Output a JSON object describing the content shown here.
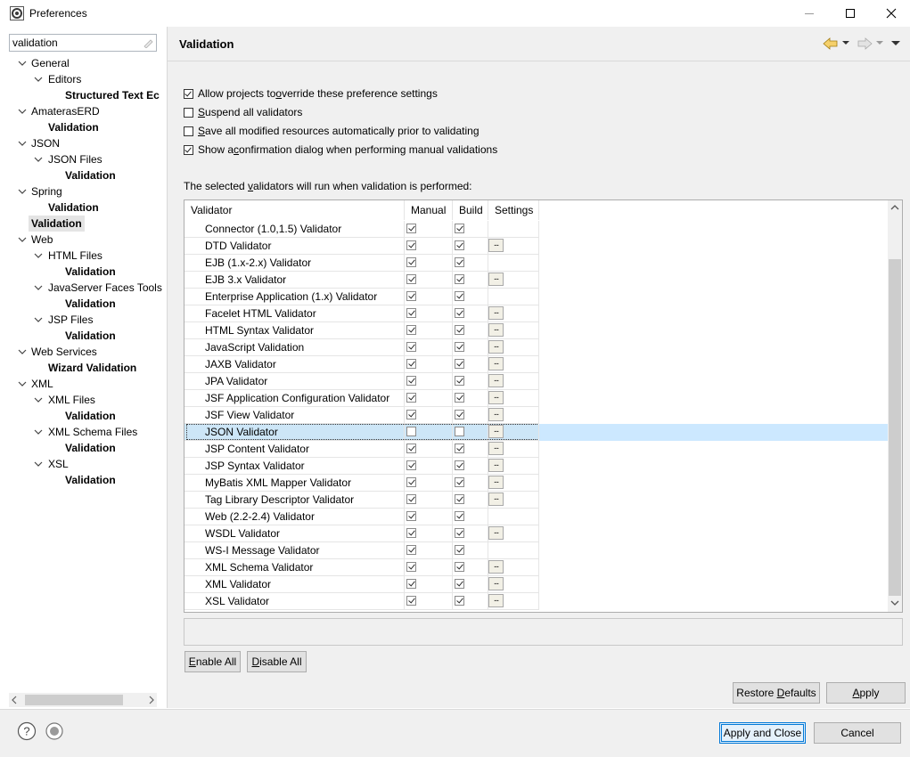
{
  "window": {
    "title": "Preferences",
    "controls": {
      "minimize": "minimize-icon",
      "maximize": "maximize-icon",
      "close": "close-icon"
    }
  },
  "filter": {
    "value": "validation"
  },
  "tree": [
    {
      "label": "General",
      "level": 0,
      "expanded": true,
      "bold": false
    },
    {
      "label": "Editors",
      "level": 1,
      "expanded": true,
      "bold": false
    },
    {
      "label": "Structured Text Ec",
      "level": 2,
      "bold": true
    },
    {
      "label": "AmaterasERD",
      "level": 0,
      "expanded": true,
      "bold": false
    },
    {
      "label": "Validation",
      "level": 1,
      "bold": true,
      "leaf": true
    },
    {
      "label": "JSON",
      "level": 0,
      "expanded": true,
      "bold": false
    },
    {
      "label": "JSON Files",
      "level": 1,
      "expanded": true,
      "bold": false
    },
    {
      "label": "Validation",
      "level": 2,
      "bold": true
    },
    {
      "label": "Spring",
      "level": 0,
      "expanded": true,
      "bold": false
    },
    {
      "label": "Validation",
      "level": 1,
      "bold": true,
      "leaf": true
    },
    {
      "label": "Validation",
      "level": 0,
      "bold": true,
      "selected": true
    },
    {
      "label": "Web",
      "level": 0,
      "expanded": true,
      "bold": false
    },
    {
      "label": "HTML Files",
      "level": 1,
      "expanded": true,
      "bold": false
    },
    {
      "label": "Validation",
      "level": 2,
      "bold": true
    },
    {
      "label": "JavaServer Faces Tools",
      "level": 1,
      "expanded": true,
      "bold": false
    },
    {
      "label": "Validation",
      "level": 2,
      "bold": true
    },
    {
      "label": "JSP Files",
      "level": 1,
      "expanded": true,
      "bold": false
    },
    {
      "label": "Validation",
      "level": 2,
      "bold": true
    },
    {
      "label": "Web Services",
      "level": 0,
      "expanded": true,
      "bold": false
    },
    {
      "label": "Wizard Validation",
      "level": 1,
      "bold": true,
      "leaf": true
    },
    {
      "label": "XML",
      "level": 0,
      "expanded": true,
      "bold": false
    },
    {
      "label": "XML Files",
      "level": 1,
      "expanded": true,
      "bold": false
    },
    {
      "label": "Validation",
      "level": 2,
      "bold": true
    },
    {
      "label": "XML Schema Files",
      "level": 1,
      "expanded": true,
      "bold": false
    },
    {
      "label": "Validation",
      "level": 2,
      "bold": true
    },
    {
      "label": "XSL",
      "level": 1,
      "expanded": true,
      "bold": false
    },
    {
      "label": "Validation",
      "level": 2,
      "bold": true
    }
  ],
  "page": {
    "title": "Validation"
  },
  "options": [
    {
      "pre": "Allow projects to ",
      "u": "o",
      "post": "verride these preference settings",
      "checked": true
    },
    {
      "pre": "",
      "u": "S",
      "post": "uspend all validators",
      "checked": false
    },
    {
      "pre": "",
      "u": "S",
      "post": "ave all modified resources automatically prior to validating",
      "checked": false
    },
    {
      "pre": "Show a ",
      "u": "c",
      "post": "onfirmation dialog when performing manual validations",
      "checked": true
    }
  ],
  "description": {
    "pre": "The selected ",
    "u": "v",
    "post": "alidators will run when validation is performed:"
  },
  "table": {
    "headers": {
      "validator": "Validator",
      "manual": "Manual",
      "build": "Build",
      "settings": "Settings"
    },
    "rows": [
      {
        "name": "Connector (1.0,1.5) Validator",
        "manual": true,
        "build": true,
        "settings": false
      },
      {
        "name": "DTD Validator",
        "manual": true,
        "build": true,
        "settings": true
      },
      {
        "name": "EJB (1.x-2.x) Validator",
        "manual": true,
        "build": true,
        "settings": false
      },
      {
        "name": "EJB 3.x Validator",
        "manual": true,
        "build": true,
        "settings": true
      },
      {
        "name": "Enterprise Application (1.x) Validator",
        "manual": true,
        "build": true,
        "settings": false
      },
      {
        "name": "Facelet HTML Validator",
        "manual": true,
        "build": true,
        "settings": true
      },
      {
        "name": "HTML Syntax Validator",
        "manual": true,
        "build": true,
        "settings": true
      },
      {
        "name": "JavaScript Validation",
        "manual": true,
        "build": true,
        "settings": true
      },
      {
        "name": "JAXB Validator",
        "manual": true,
        "build": true,
        "settings": true
      },
      {
        "name": "JPA Validator",
        "manual": true,
        "build": true,
        "settings": true
      },
      {
        "name": "JSF Application Configuration Validator",
        "manual": true,
        "build": true,
        "settings": true
      },
      {
        "name": "JSF View Validator",
        "manual": true,
        "build": true,
        "settings": true
      },
      {
        "name": "JSON Validator",
        "manual": false,
        "build": false,
        "settings": true,
        "selected": true
      },
      {
        "name": "JSP Content Validator",
        "manual": true,
        "build": true,
        "settings": true
      },
      {
        "name": "JSP Syntax Validator",
        "manual": true,
        "build": true,
        "settings": true
      },
      {
        "name": "MyBatis XML Mapper Validator",
        "manual": true,
        "build": true,
        "settings": true
      },
      {
        "name": "Tag Library Descriptor Validator",
        "manual": true,
        "build": true,
        "settings": true
      },
      {
        "name": "Web (2.2-2.4) Validator",
        "manual": true,
        "build": true,
        "settings": false
      },
      {
        "name": "WSDL Validator",
        "manual": true,
        "build": true,
        "settings": true
      },
      {
        "name": "WS-I Message Validator",
        "manual": true,
        "build": true,
        "settings": false
      },
      {
        "name": "XML Schema Validator",
        "manual": true,
        "build": true,
        "settings": true
      },
      {
        "name": "XML Validator",
        "manual": true,
        "build": true,
        "settings": true
      },
      {
        "name": "XSL Validator",
        "manual": true,
        "build": true,
        "settings": true
      }
    ],
    "settings_glyph": "..."
  },
  "buttons": {
    "enable_all": {
      "u": "E",
      "post": "nable All"
    },
    "disable_all": {
      "u": "D",
      "post": "isable All"
    },
    "restore_defaults": {
      "pre": "Restore ",
      "u": "D",
      "post": "efaults"
    },
    "apply": {
      "u": "A",
      "post": "pply"
    },
    "apply_close": "Apply and Close",
    "cancel": "Cancel"
  },
  "bottom_icons": [
    "help-icon",
    "record-icon"
  ]
}
